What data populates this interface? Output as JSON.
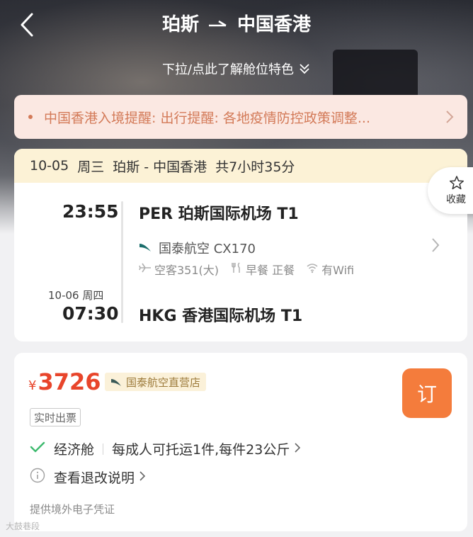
{
  "header": {
    "origin": "珀斯",
    "destination": "中国香港",
    "pull_hint": "下拉/点此了解舱位特色"
  },
  "notice": {
    "text": "中国香港入境提醒: 出行提醒: 各地疫情防控政策调整..."
  },
  "flight": {
    "date": "10-05",
    "weekday": "周三",
    "route": "珀斯 - 中国香港",
    "duration": "共7小时35分",
    "departure_time": "23:55",
    "departure_airport": "PER 珀斯国际机场 T1",
    "airline": "国泰航空 CX170",
    "aircraft": "空客351(大)",
    "meals": "早餐 正餐",
    "wifi": "有Wifi",
    "arrival_date": "10-06 周四",
    "arrival_time": "07:30",
    "arrival_airport": "HKG 香港国际机场 T1"
  },
  "favorite": {
    "label": "收藏"
  },
  "offer": {
    "currency": "¥",
    "price": "3726",
    "store": "国泰航空直营店",
    "book_label": "订",
    "tag": "实时出票",
    "cabin": "经济舱",
    "baggage": "每成人可托运1件,每件23公斤",
    "refund": "查看退改说明",
    "voucher": "提供境外电子凭证"
  },
  "watermark": {
    "text": "大鼓巷段"
  },
  "colors": {
    "accent": "#f47c3c",
    "price": "#e8452b",
    "notice_bg": "#fbe8e2",
    "notice_text": "#d37a58",
    "flight_head_bg": "#fcf2d6",
    "check": "#3dba6e"
  },
  "icons": {
    "back": "chevron-left-icon",
    "arrow": "arrow-right-icon",
    "pull": "double-chevron-down-icon",
    "star": "star-icon",
    "plane": "plane-icon",
    "meal": "fork-knife-icon",
    "wifi": "wifi-icon",
    "check": "check-icon",
    "info": "info-icon"
  }
}
